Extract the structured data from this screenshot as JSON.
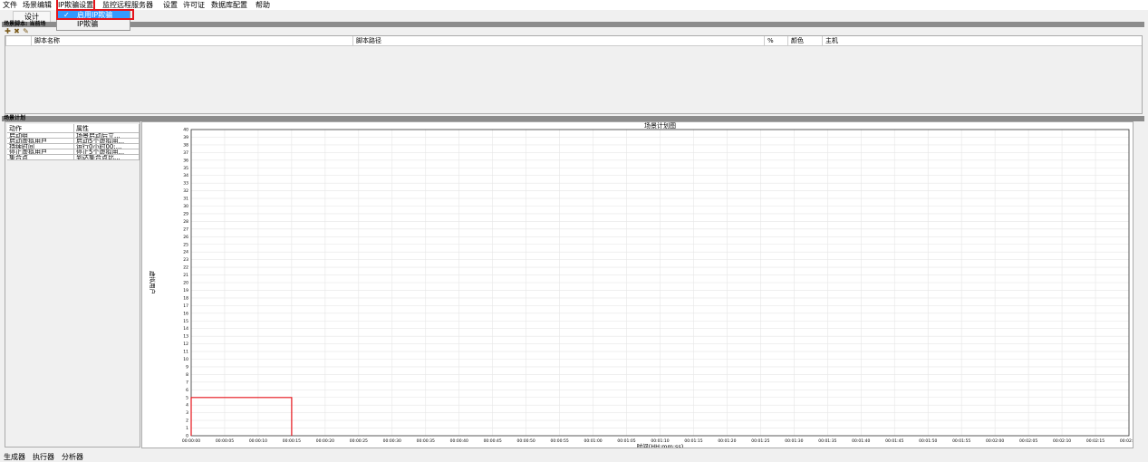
{
  "menubar": {
    "items": [
      {
        "label": "文件"
      },
      {
        "label": "场景编辑"
      },
      {
        "label": "IP欺骗设置"
      },
      {
        "label": "监控远程服务器"
      },
      {
        "label": "设置"
      },
      {
        "label": "许可证"
      },
      {
        "label": "数据库配置"
      },
      {
        "label": "帮助"
      }
    ]
  },
  "dropdown": {
    "items": [
      {
        "check": "✓",
        "label": "启用IP欺骗",
        "selected": true
      },
      {
        "check": "",
        "label": "IP欺骗",
        "selected": false
      }
    ]
  },
  "tabs": {
    "design": "设计"
  },
  "sections": {
    "scripts": "场景脚本: 当前场",
    "schedule": "场景计划"
  },
  "toolbar": {
    "add_icon": "add-script-icon",
    "remove_icon": "remove-script-icon",
    "edit_icon": "edit-script-icon"
  },
  "script_table": {
    "columns": [
      "脚本名称",
      "脚本路径",
      "%",
      "颜色",
      "主机"
    ]
  },
  "actions_table": {
    "columns": [
      "动作",
      "属性"
    ],
    "rows": [
      [
        "启动组",
        "场景启动后立..."
      ],
      [
        "启动虚拟用户",
        "启动5个虚拟用..."
      ],
      [
        "持续时间",
        "运行0小时00:..."
      ],
      [
        "停止虚拟用户",
        "停止5个虚拟用..."
      ],
      [
        "集合点",
        "到达集合点比..."
      ]
    ]
  },
  "chart_data": {
    "type": "line",
    "title": "场景计划图",
    "xlabel": "时间(HH:mm:ss)",
    "ylabel": "虚拟用户",
    "ylim": [
      0,
      40
    ],
    "yticks": [
      0,
      1,
      2,
      3,
      4,
      5,
      6,
      7,
      8,
      9,
      10,
      11,
      12,
      13,
      14,
      15,
      16,
      17,
      18,
      19,
      20,
      21,
      22,
      23,
      24,
      25,
      26,
      27,
      28,
      29,
      30,
      31,
      32,
      33,
      34,
      35,
      36,
      37,
      38,
      39,
      40
    ],
    "xticks": [
      "00:00:00",
      "00:00:05",
      "00:00:10",
      "00:00:15",
      "00:00:20",
      "00:00:25",
      "00:00:30",
      "00:00:35",
      "00:00:40",
      "00:00:45",
      "00:00:50",
      "00:00:55",
      "00:01:00",
      "00:01:05",
      "00:01:10",
      "00:01:15",
      "00:01:20",
      "00:01:25",
      "00:01:30",
      "00:01:35",
      "00:01:40",
      "00:01:45",
      "00:01:50",
      "00:01:55",
      "00:02:00",
      "00:02:05",
      "00:02:10",
      "00:02:15",
      "00:02:20"
    ],
    "xlim_seconds": [
      0,
      140
    ],
    "grid": true,
    "series": [
      {
        "color": "#e5141b",
        "x": [
          0,
          0,
          15,
          15
        ],
        "y": [
          0,
          5,
          5,
          0
        ]
      }
    ]
  },
  "bottom_tabs": [
    {
      "label": "生成器"
    },
    {
      "label": "执行器"
    },
    {
      "label": "分析器"
    }
  ]
}
